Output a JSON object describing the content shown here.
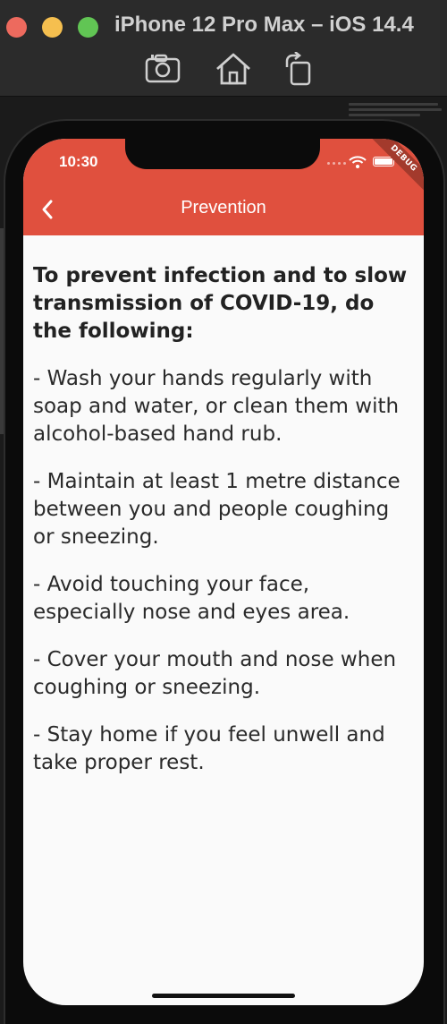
{
  "simulator": {
    "title": "iPhone 12 Pro Max – iOS 14.4",
    "toolbar": [
      "screenshot-icon",
      "home-icon",
      "rotate-icon"
    ]
  },
  "status_bar": {
    "time": "10:30",
    "debug_label": "DEBUG"
  },
  "app_bar": {
    "title": "Prevention",
    "back_icon": "chevron-left-icon",
    "color": "#e0503e"
  },
  "content": {
    "heading": "To prevent infection and to slow transmission of COVID-19, do the following:",
    "tips": [
      "- Wash your hands regularly with soap and water, or clean them with alcohol-based hand rub.",
      "- Maintain at least 1 metre distance between you and people coughing or sneezing.",
      "- Avoid touching your face, especially nose and eyes area.",
      "- Cover your mouth and nose when coughing or sneezing.",
      "- Stay home if you feel unwell and take proper rest."
    ]
  },
  "corner_glyph": "%"
}
